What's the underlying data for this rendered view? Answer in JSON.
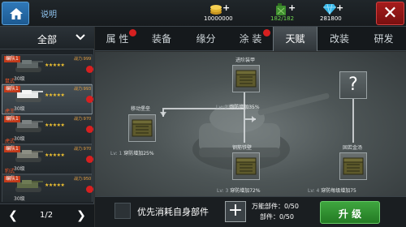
{
  "topbar": {
    "help_label": "说明",
    "gold": "10000000",
    "fuel": "182/182",
    "diamonds": "281800",
    "close_label": "✕"
  },
  "sidebar": {
    "filter_label": "全部",
    "tanks": [
      {
        "squad": "编队1",
        "power": "战力:999",
        "level": "30级",
        "stars": "★★★★★",
        "name": "鼠式"
      },
      {
        "squad": "编队1",
        "power": "战力:993",
        "level": "30级",
        "stars": "★★★★★",
        "name": "虎王"
      },
      {
        "squad": "编队1",
        "power": "战力:970",
        "level": "30级",
        "stars": "★★★★★",
        "name": "虎式"
      },
      {
        "squad": "编队1",
        "power": "战力:970",
        "level": "30级",
        "stars": "★★★★★",
        "name": "豹式"
      },
      {
        "squad": "编队1",
        "power": "战力:950",
        "level": "30级",
        "stars": "★★★★★",
        "name": ""
      }
    ],
    "page": "1/2"
  },
  "tabs": [
    {
      "label": "属 性",
      "badge": true,
      "active": false
    },
    {
      "label": "装备",
      "badge": false,
      "active": false
    },
    {
      "label": "缘分",
      "badge": false,
      "active": false
    },
    {
      "label": "涂 装",
      "badge": true,
      "active": false
    },
    {
      "label": "天赋",
      "badge": false,
      "active": true
    },
    {
      "label": "改装",
      "badge": false,
      "active": false
    },
    {
      "label": "研发",
      "badge": false,
      "active": false
    }
  ],
  "talents": {
    "top": {
      "title": "进阶装甲",
      "level": "Lv: 2",
      "desc": "炮防增加35%"
    },
    "left": {
      "title": "移动堡垒",
      "level": "Lv: 1",
      "desc": "穿防增加25%"
    },
    "mid": {
      "title": "钢筋铁壁",
      "level": "Lv: 3",
      "desc": "穿防增加72%"
    },
    "right": {
      "title": "固若金汤",
      "level": "Lv: 4",
      "desc": "穿防每级增加75"
    },
    "unknown": {
      "label": "?"
    }
  },
  "bottom": {
    "priority_label": "优先消耗自身部件",
    "plus_label": "+",
    "universal_parts": "万能部件：0/50",
    "parts": "部件：0/50",
    "upgrade_label": "升 级"
  },
  "colors": {
    "upgrade_button": "#2e8f2e",
    "badge": "#d62020",
    "close_button": "#8f1616"
  }
}
